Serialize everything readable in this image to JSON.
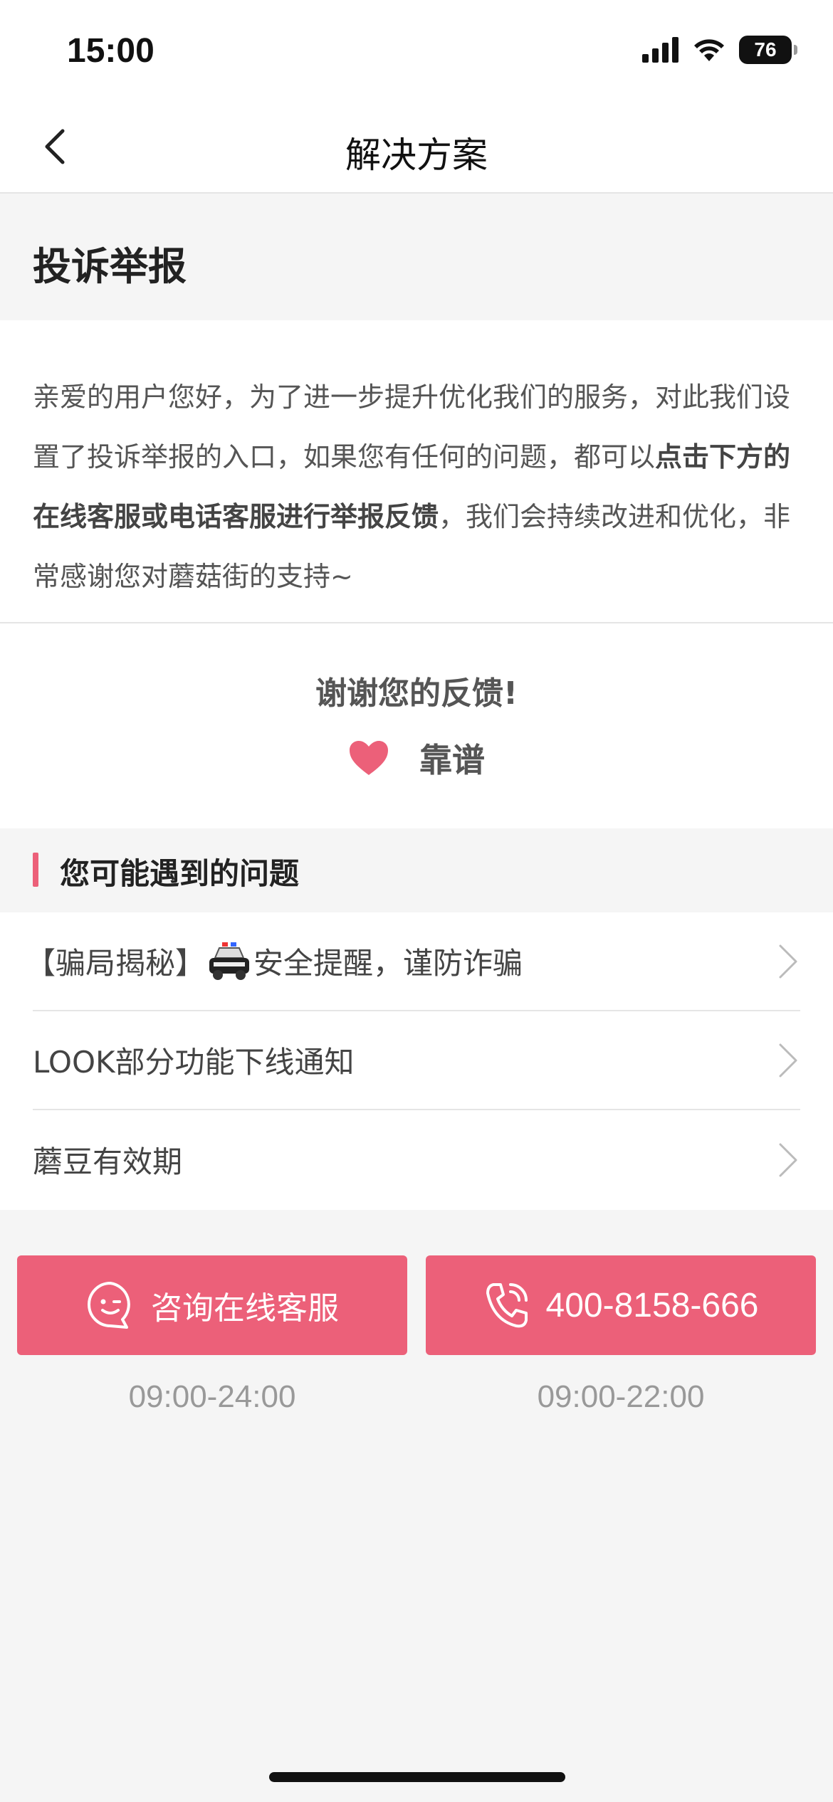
{
  "status": {
    "time": "15:00",
    "battery": "76"
  },
  "nav": {
    "title": "解决方案"
  },
  "section": {
    "title": "投诉举报"
  },
  "description": {
    "part1": "亲爱的用户您好，为了进一步提升优化我们的服务，对此我们设置了投诉举报的入口，如果您有任何的问题，都可以",
    "bold": "点击下方的在线客服或电话客服进行举报反馈",
    "part2": "，我们会持续改进和优化，非常感谢您对蘑菇街的支持~"
  },
  "feedback": {
    "title": "谢谢您的反馈!",
    "label": "靠谱"
  },
  "problems": {
    "title": "您可能遇到的问题",
    "items": [
      {
        "prefix": "【骗局揭秘】",
        "suffix": "安全提醒，谨防诈骗"
      },
      {
        "prefix": "LOOK部分功能下线通知",
        "suffix": ""
      },
      {
        "prefix": "蘑豆有效期",
        "suffix": ""
      }
    ]
  },
  "contact": {
    "chat_label": "咨询在线客服",
    "phone_label": "400-8158-666",
    "chat_hours": "09:00-24:00",
    "phone_hours": "09:00-22:00"
  },
  "colors": {
    "accent": "#ec6079"
  }
}
